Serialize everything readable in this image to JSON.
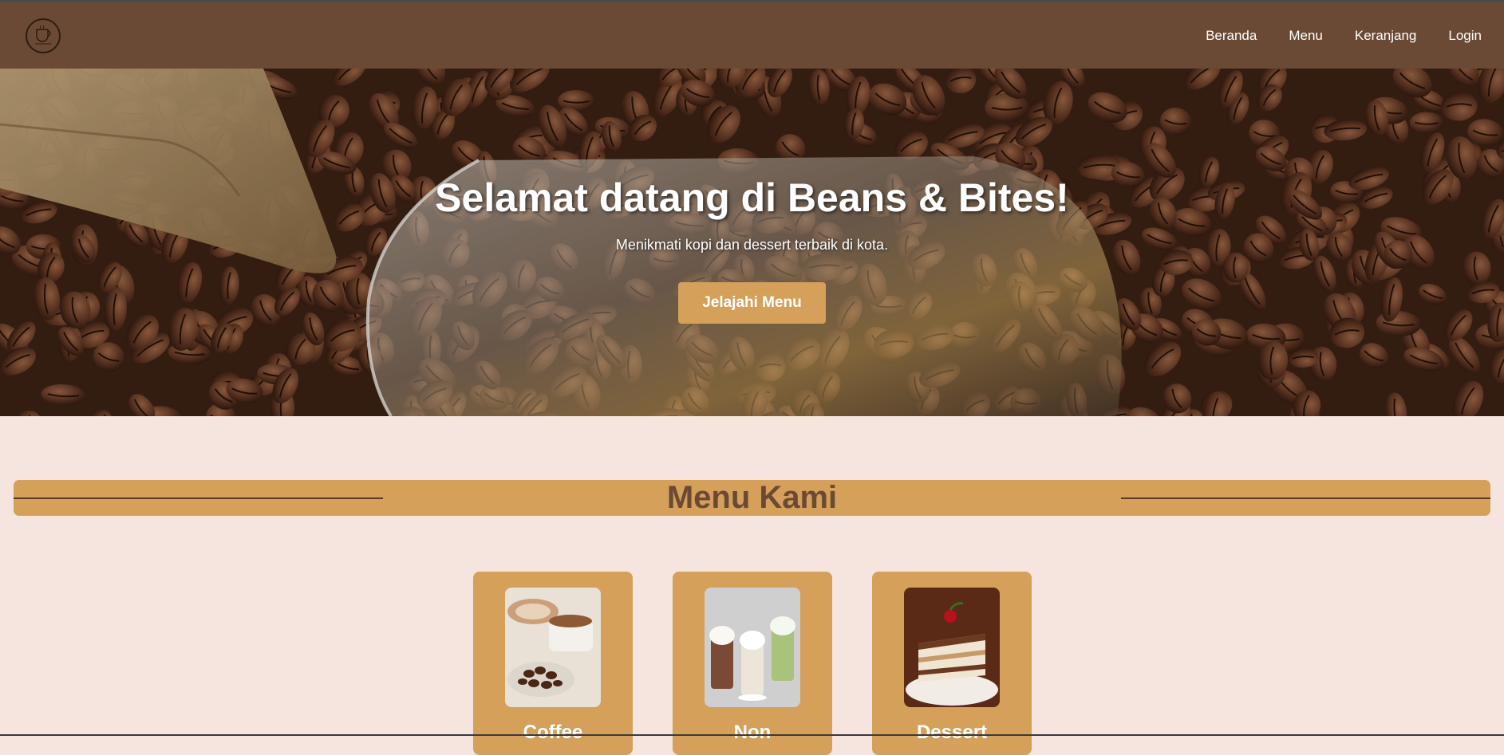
{
  "navbar": {
    "brand": "Beans & Bites",
    "links": [
      {
        "label": "Beranda"
      },
      {
        "label": "Menu"
      },
      {
        "label": "Keranjang"
      },
      {
        "label": "Login"
      }
    ]
  },
  "hero": {
    "title": "Selamat datang di Beans & Bites!",
    "subtitle": "Menikmati kopi dan dessert terbaik di kota.",
    "button_label": "Jelajahi Menu"
  },
  "menu_section": {
    "title": "Menu Kami",
    "categories": [
      {
        "label": "Coffee"
      },
      {
        "label": "Non"
      },
      {
        "label": "Dessert"
      }
    ]
  },
  "colors": {
    "navbar": "#6b4a35",
    "page_background": "#f6e4de",
    "accent": "#d4a05a",
    "heading_brown": "#6b4a35"
  }
}
